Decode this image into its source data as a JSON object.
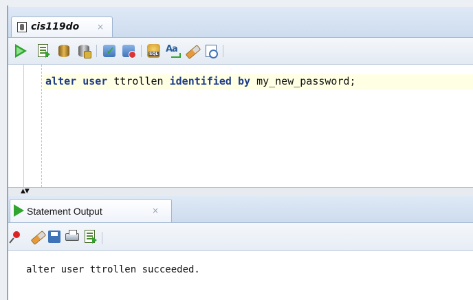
{
  "editor_tab": {
    "title": "cis119do",
    "close": "×"
  },
  "toolbar": {
    "buttons": [
      "run-statement-icon",
      "run-script-icon",
      "autotrace-icon",
      "explain-plan-icon",
      "commit-icon",
      "rollback-icon",
      "sql-tuning-icon",
      "to-upper-lower-icon",
      "clear-icon",
      "sql-history-icon"
    ]
  },
  "editor": {
    "line1": {
      "kw1": "alter",
      "kw2": "user",
      "ident1": "ttrollen",
      "kw3": "identified",
      "kw4": "by",
      "ident2": "my_new_password;"
    }
  },
  "splitter": {
    "arrows": "▲▼"
  },
  "output_tab": {
    "title": "Statement Output",
    "close": "×"
  },
  "output_toolbar": {
    "buttons": [
      "pin-icon",
      "clear-icon",
      "save-icon",
      "print-icon",
      "open-file-icon"
    ]
  },
  "output": {
    "text": "alter user ttrollen succeeded."
  },
  "colors": {
    "keyword": "#1f3d8a",
    "run_green": "#2fa52f",
    "current_line": "#ffffe4"
  }
}
